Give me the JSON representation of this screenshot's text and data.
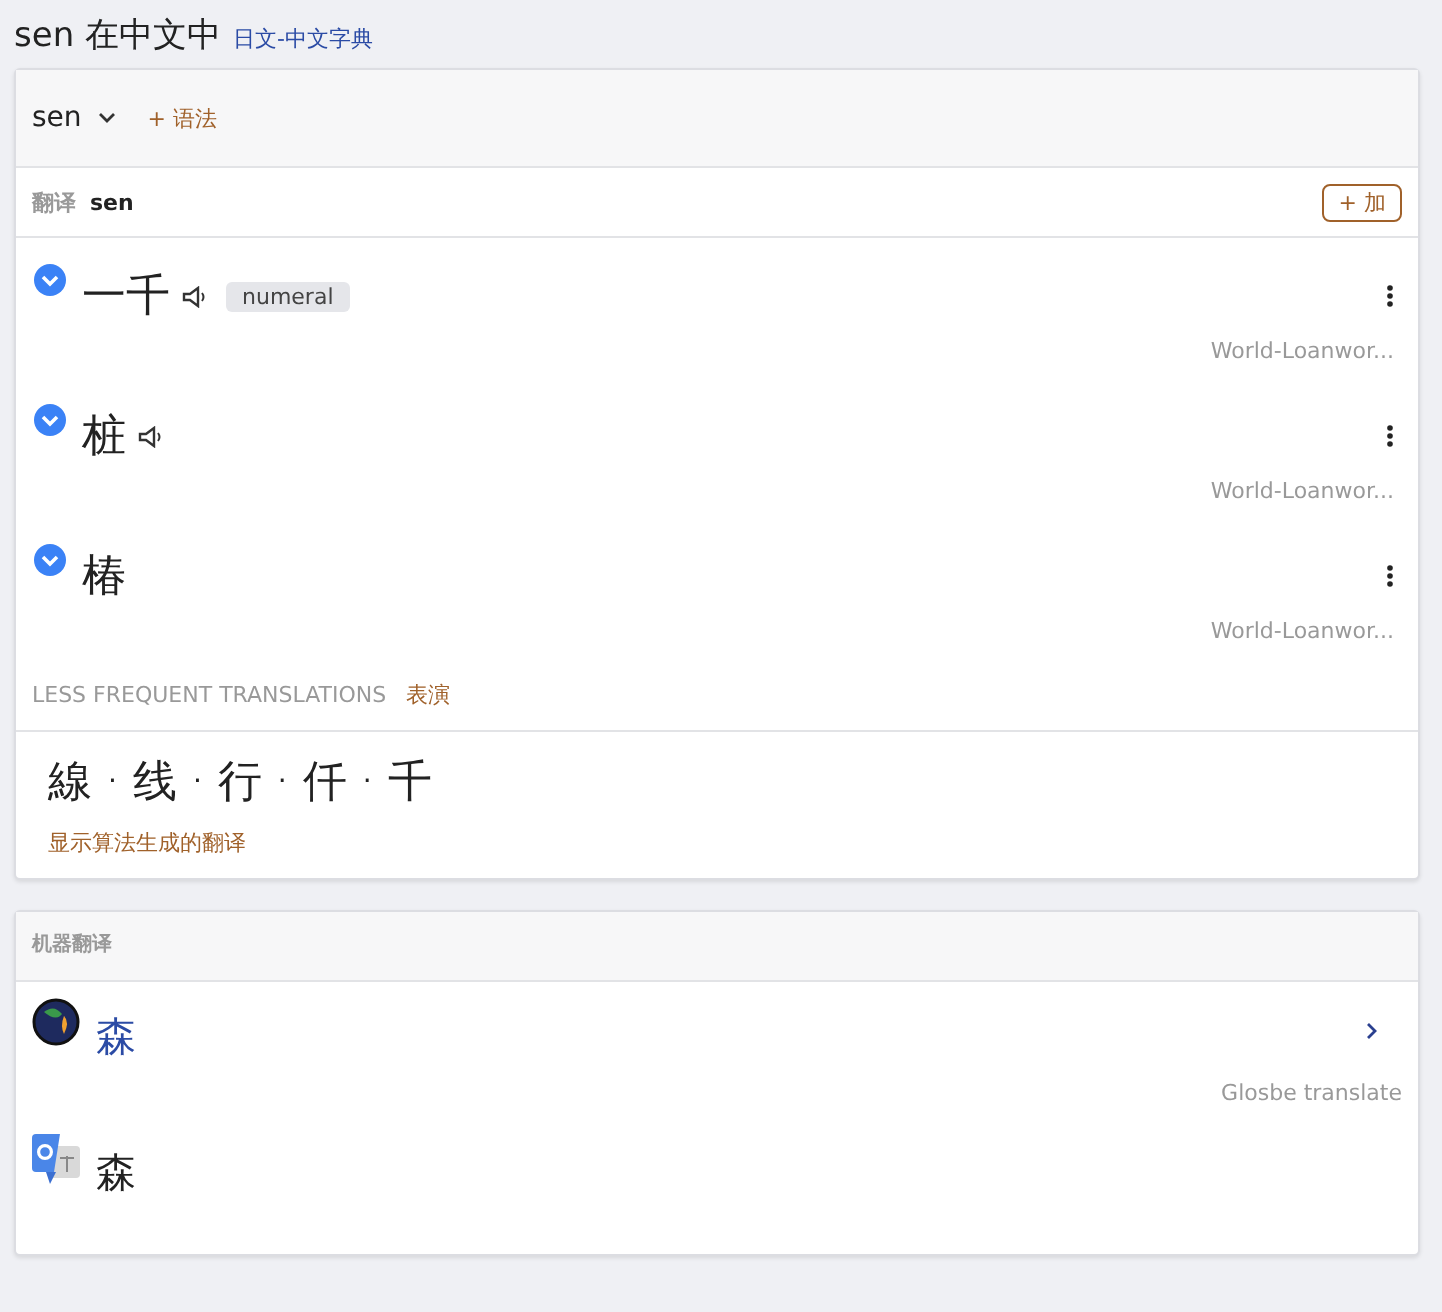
{
  "heading": {
    "word": "sen 在中文中",
    "dictionary_link": "日文-中文字典"
  },
  "entry": {
    "headword": "sen",
    "grammar_link": "+ 语法"
  },
  "translations": {
    "label": "翻译",
    "term": "sen",
    "add_button": "+ 加",
    "items": [
      {
        "text": "一千",
        "audio": true,
        "tag": "numeral",
        "source": "World-Loanwor..."
      },
      {
        "text": "桩",
        "audio": true,
        "source": "World-Loanwor..."
      },
      {
        "text": "椿",
        "audio": false,
        "source": "World-Loanwor..."
      }
    ]
  },
  "less_frequent": {
    "label": "LESS FREQUENT TRANSLATIONS",
    "link": "表演",
    "words": [
      "線",
      "线",
      "行",
      "仟",
      "千"
    ],
    "separator": "·",
    "show_algorithmic": "显示算法生成的翻译"
  },
  "machine": {
    "label": "机器翻译",
    "items": [
      {
        "kind": "glosbe",
        "text": "森",
        "source": "Glosbe translate"
      },
      {
        "kind": "google",
        "text": "森"
      }
    ]
  }
}
